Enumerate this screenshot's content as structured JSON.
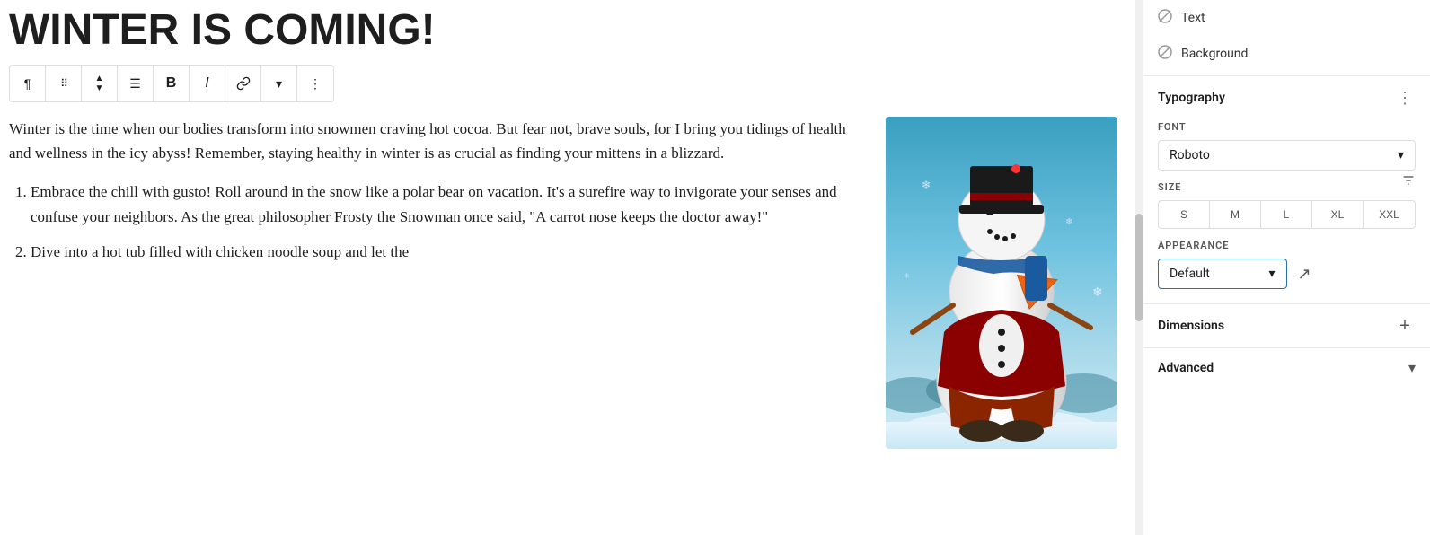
{
  "toolbar": {
    "buttons": [
      {
        "id": "paragraph",
        "label": "¶",
        "type": "text"
      },
      {
        "id": "drag",
        "label": "⠿",
        "type": "icon"
      },
      {
        "id": "move",
        "label": "⌃⌄",
        "type": "icon"
      },
      {
        "id": "align",
        "label": "≡",
        "type": "icon"
      },
      {
        "id": "bold",
        "label": "B",
        "type": "text"
      },
      {
        "id": "italic",
        "label": "I",
        "type": "text"
      },
      {
        "id": "link",
        "label": "🔗",
        "type": "icon"
      },
      {
        "id": "dropdown",
        "label": "▾",
        "type": "icon"
      },
      {
        "id": "more",
        "label": "⋮",
        "type": "icon"
      }
    ]
  },
  "page_title": "WINTER IS COMING!",
  "main_text": "Winter is the time when our bodies transform into snowmen craving hot cocoa. But fear not, brave souls, for I bring you tidings of health and wellness in the icy abyss! Remember, staying healthy in winter is as crucial as finding your mittens in a blizzard.",
  "list_items": [
    "Embrace the chill with gusto! Roll around in the snow like a polar bear on vacation. It's a surefire way to invigorate your senses and confuse your neighbors. As the great philosopher Frosty the Snowman once said, \"A carrot nose keeps the doctor away!\"",
    "Dive into a hot tub filled with chicken noodle soup and let the"
  ],
  "sidebar": {
    "text_label": "Text",
    "background_label": "Background",
    "typography_section": {
      "title": "Typography",
      "menu_icon": "⋮",
      "font_label": "FONT",
      "font_value": "Roboto",
      "font_dropdown_icon": "▾",
      "size_label": "SIZE",
      "size_options": [
        "S",
        "M",
        "L",
        "XL",
        "XXL"
      ],
      "appearance_label": "APPEARANCE",
      "appearance_value": "Default",
      "appearance_dropdown_icon": "▾"
    },
    "dimensions_section": {
      "title": "Dimensions",
      "plus_icon": "+"
    },
    "advanced_section": {
      "title": "Advanced",
      "chevron_icon": "▾"
    }
  },
  "colors": {
    "accent_blue": "#2271b1",
    "border": "#ddd",
    "text_primary": "#1e1e1e",
    "text_secondary": "#555",
    "bg_white": "#ffffff"
  }
}
